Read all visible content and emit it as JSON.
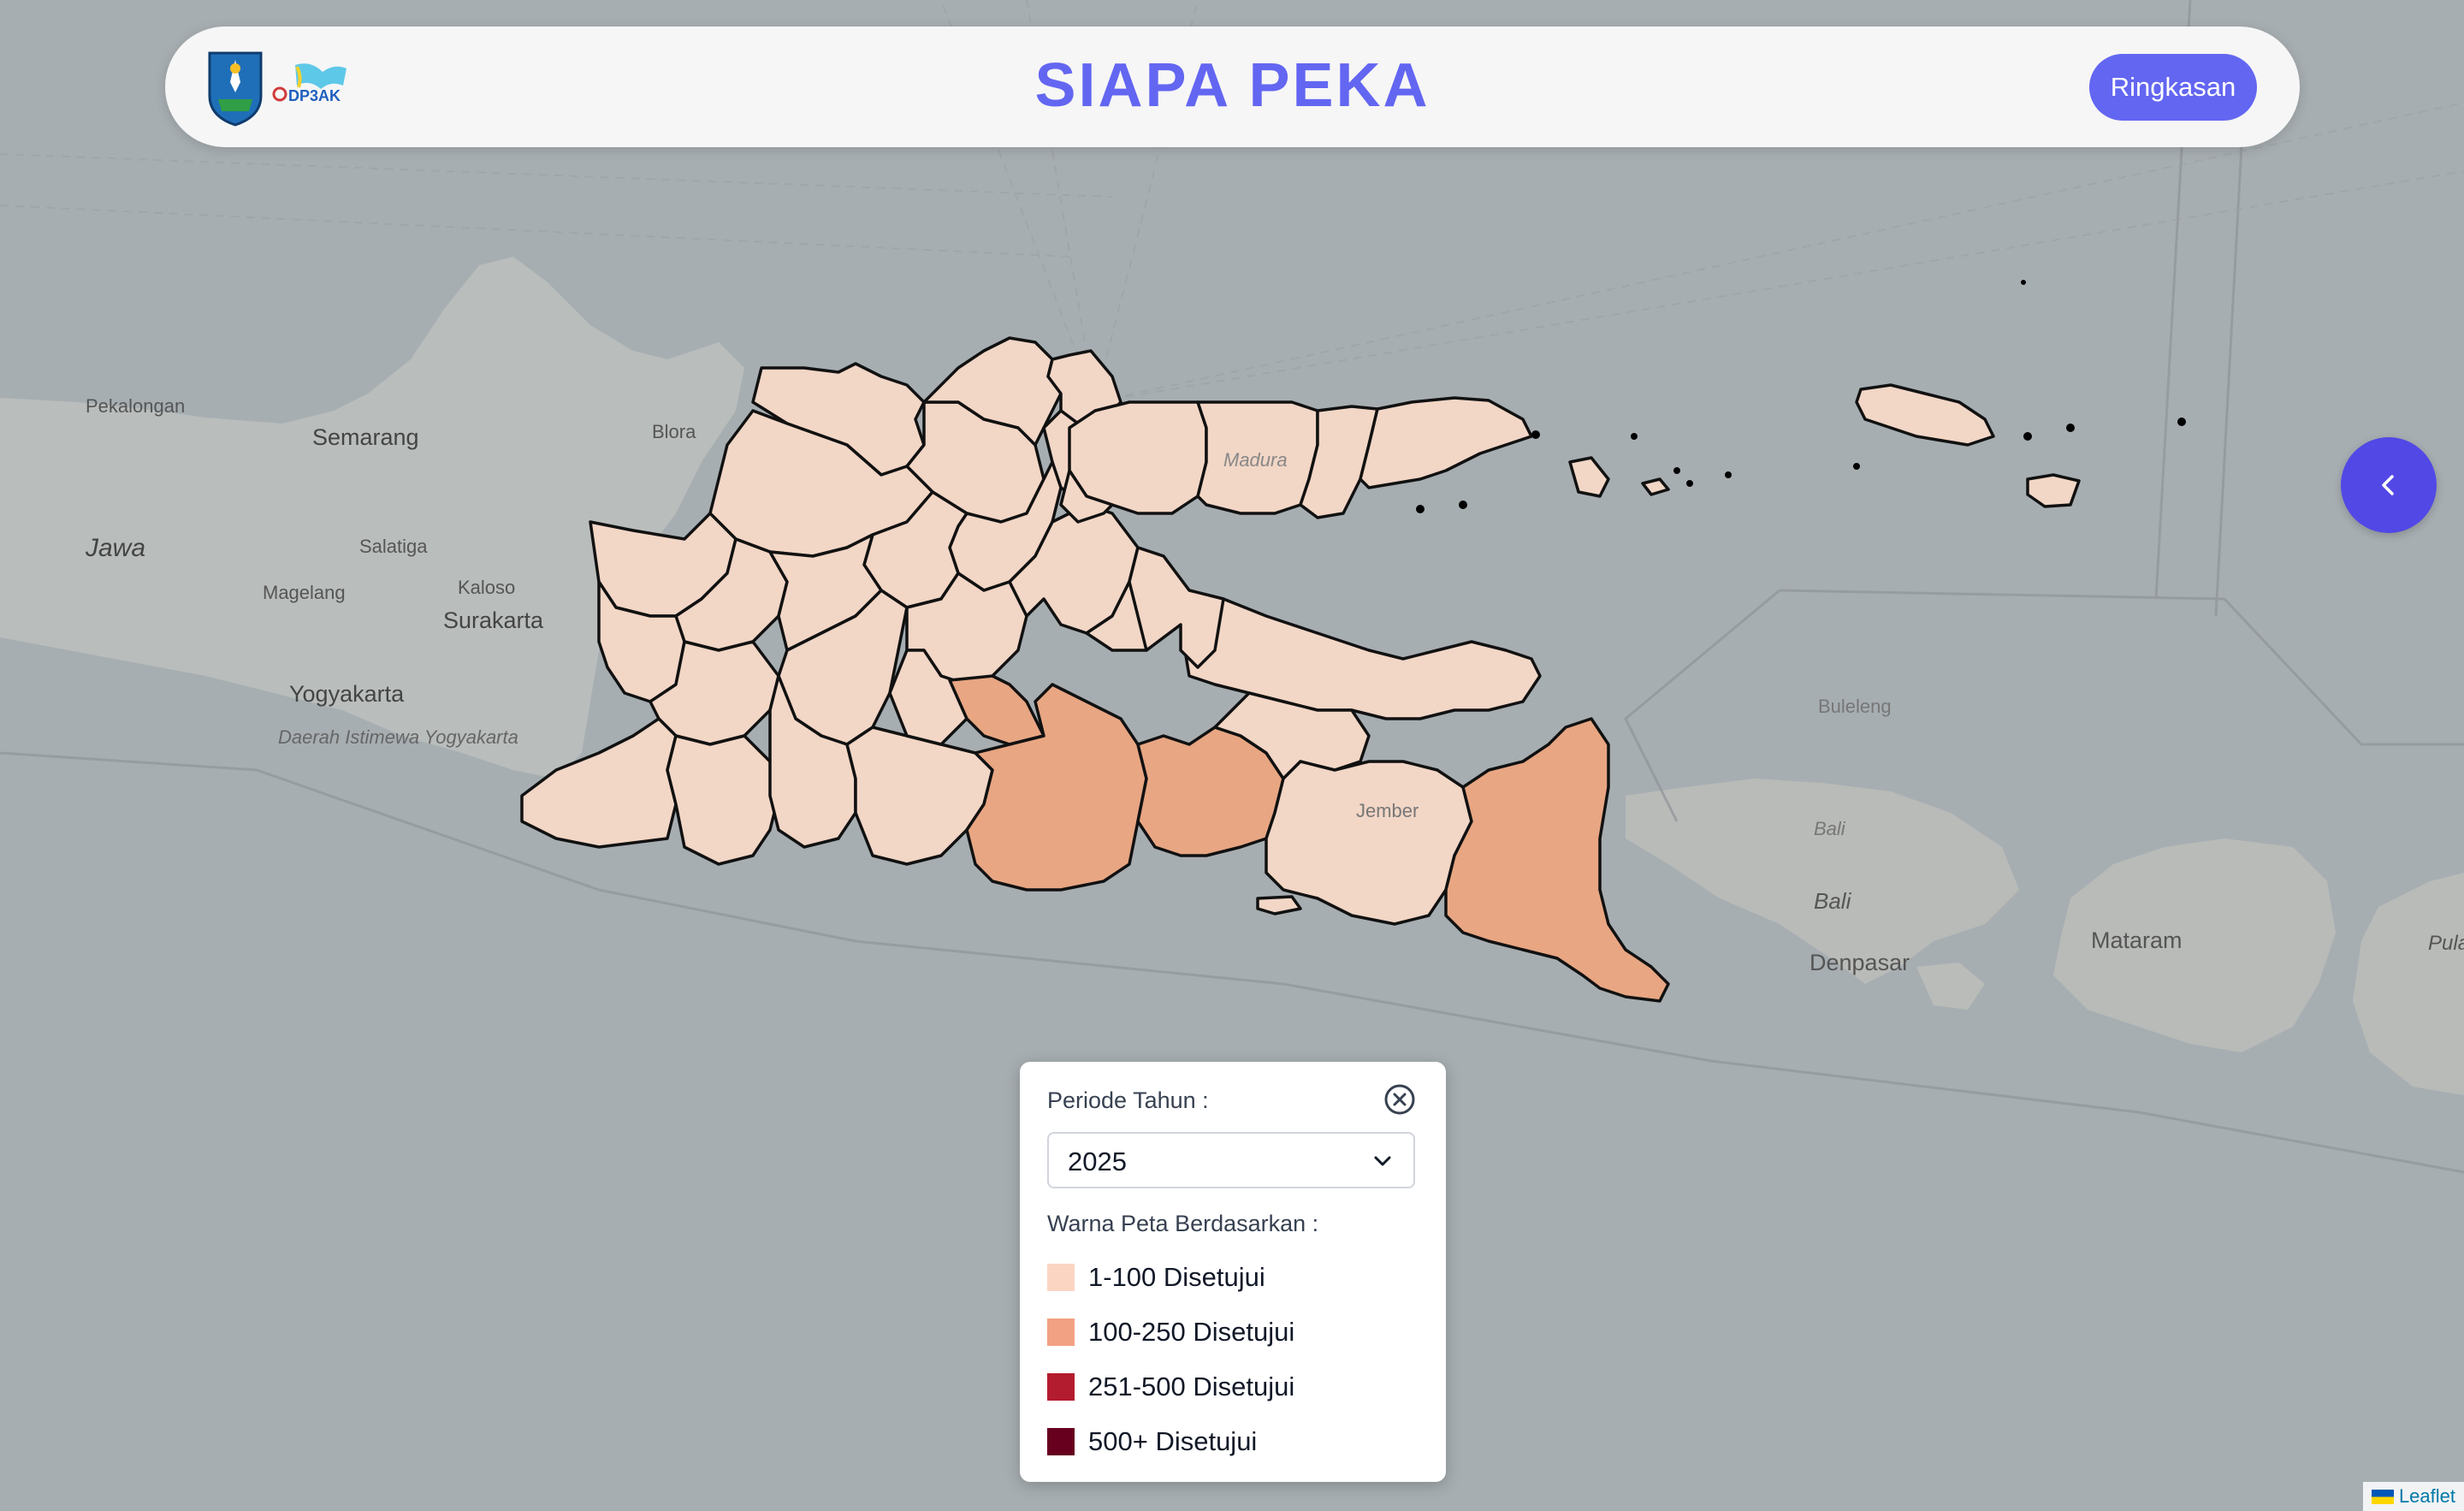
{
  "header": {
    "title": "SIAPA PEKA",
    "summary_button": "Ringkasan",
    "logo_text": "DP3AK"
  },
  "map": {
    "place_labels": [
      "Pekalongan",
      "Semarang",
      "Blora",
      "Jawa",
      "Salatiga",
      "Magelang",
      "Kaloso",
      "Surakarta",
      "Yogyakarta",
      "Daerah Istimewa Yogyakarta",
      "Madura",
      "Buleleng",
      "Bali",
      "Bali",
      "Denpasar",
      "Mataram",
      "Pula",
      "Jember"
    ],
    "colors": {
      "low": "#f2d4c2",
      "mid": "#e8a683",
      "high": "#b31b2e",
      "max": "#67001f"
    }
  },
  "panel": {
    "period_label": "Periode Tahun :",
    "year_value": "2025",
    "color_label": "Warna Peta Berdasarkan :",
    "legend": [
      {
        "label": "1-100 Disetujui",
        "color": "#fcd5c2"
      },
      {
        "label": "100-250 Disetujui",
        "color": "#f2a183"
      },
      {
        "label": "251-500 Disetujui",
        "color": "#b31b2e"
      },
      {
        "label": "500+ Disetujui",
        "color": "#67001f"
      }
    ]
  },
  "attribution": {
    "text": "Leaflet"
  }
}
